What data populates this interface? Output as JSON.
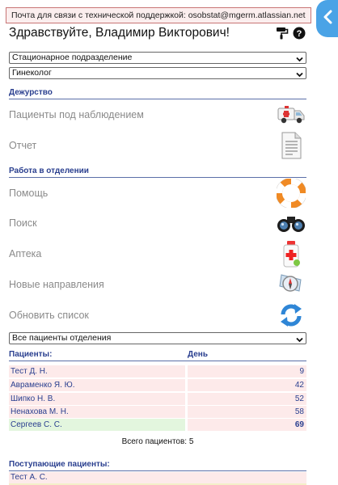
{
  "support_notice": "Почта для связи с технической поддержкой: osobstat@mgerm.atlassian.net",
  "greeting": "Здравствуйте, Владимир Викторович!",
  "selects": {
    "department": "Стационарное подразделение",
    "specialty": "Гинеколог",
    "patient_filter": "Все пациенты отделения"
  },
  "sections": {
    "duty": "Дежурство",
    "ward_work": "Работа в отделении",
    "incoming": "Поступающие пациенты:"
  },
  "duty_items": [
    {
      "label": "Пациенты под наблюдением",
      "icon": "ambulance-icon"
    },
    {
      "label": "Отчет",
      "icon": "document-icon"
    }
  ],
  "ward_items": [
    {
      "label": "Помощь",
      "icon": "lifebuoy-icon"
    },
    {
      "label": "Поиск",
      "icon": "binoculars-icon"
    },
    {
      "label": "Аптека",
      "icon": "medicine-bottle-icon"
    },
    {
      "label": "Новые направления",
      "icon": "compass-icon"
    },
    {
      "label": "Обновить список",
      "icon": "refresh-icon"
    }
  ],
  "patients_table": {
    "col_patients": "Пациенты:",
    "col_day": "День",
    "rows": [
      {
        "name": "Тест Д. Н.",
        "day": "9",
        "status": "pink"
      },
      {
        "name": "Авраменко Я. Ю.",
        "day": "42",
        "status": "pink"
      },
      {
        "name": "Шипко Н. В.",
        "day": "52",
        "status": "pink"
      },
      {
        "name": "Ненахова М. Н.",
        "day": "58",
        "status": "pink"
      },
      {
        "name": "Сергеев С. С.",
        "day": "69",
        "status": "green"
      }
    ],
    "total": "Всего пациентов: 5"
  },
  "incoming_patients": [
    {
      "name": "Тест А. С."
    }
  ],
  "colors": {
    "accent_blue": "#4aa3e6",
    "section_title": "#2a3f8f",
    "row_pink": "#fdeaea",
    "row_green": "#e3f6de",
    "notice_border": "#c87575"
  }
}
